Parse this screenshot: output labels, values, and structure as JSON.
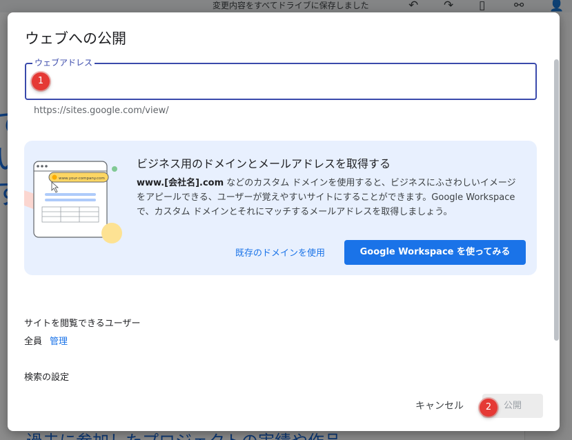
{
  "background": {
    "status_text": "変更内容をすべてドライブに保存しました",
    "bottom_text": "過去に参加したプロジェクトの実績や作品",
    "big_letters": [
      "て",
      "い",
      "す"
    ],
    "icons": [
      "undo-icon",
      "redo-icon",
      "device-preview-icon",
      "link-icon",
      "share-person-icon"
    ]
  },
  "dialog": {
    "title": "ウェブへの公開",
    "address_field": {
      "label": "ウェブアドレス",
      "value": "",
      "hint": "https://sites.google.com/view/"
    },
    "promo": {
      "title": "ビジネス用のドメインとメールアドレスを取得する",
      "body_bold": "www.[会社名].com",
      "body_text": " などのカスタム ドメインを使用すると、ビジネスにふさわしいイメージをアピールできる、ユーザーが覚えやすいサイトにすることができます。Google Workspace で、カスタム ドメインとそれにマッチするメールアドレスを取得しましょう。",
      "illustration_url_text": "www.your-company.com",
      "existing_domain_link": "既存のドメインを使用",
      "try_button": "Google Workspace を使ってみる"
    },
    "viewers": {
      "label": "サイトを閲覧できるユーザー",
      "value": "全員",
      "manage_link": "管理"
    },
    "search_settings_label": "検索の設定",
    "cancel_button": "キャンセル",
    "publish_button": "公開"
  },
  "markers": [
    "1",
    "2"
  ],
  "colors": {
    "accent": "#1a73e8",
    "field_border": "#3949ab",
    "promo_bg": "#e8f0fe",
    "marker": "#e53935"
  }
}
